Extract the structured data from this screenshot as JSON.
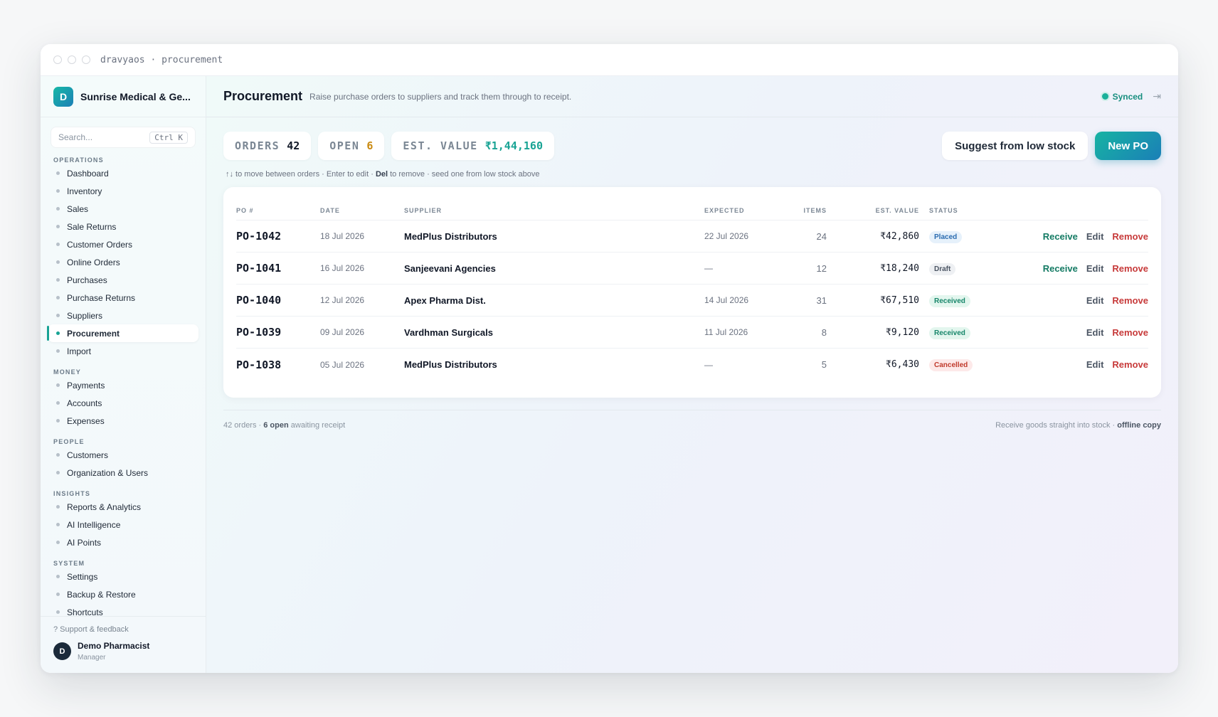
{
  "window": {
    "title": "dravyaos · procurement"
  },
  "sidebar": {
    "org": {
      "logo": "D",
      "name": "Sunrise Medical & Ge..."
    },
    "search": {
      "placeholder": "Search...",
      "shortcut": "Ctrl K"
    },
    "sections": [
      {
        "label": "OPERATIONS",
        "items": [
          "Dashboard",
          "Inventory",
          "Sales",
          "Sale Returns",
          "Customer Orders",
          "Online Orders",
          "Purchases",
          "Purchase Returns",
          "Suppliers",
          "Procurement",
          "Import"
        ]
      },
      {
        "label": "MONEY",
        "items": [
          "Payments",
          "Accounts",
          "Expenses"
        ]
      },
      {
        "label": "PEOPLE",
        "items": [
          "Customers",
          "Organization & Users"
        ]
      },
      {
        "label": "INSIGHTS",
        "items": [
          "Reports & Analytics",
          "AI Intelligence",
          "AI Points"
        ]
      },
      {
        "label": "SYSTEM",
        "items": [
          "Settings",
          "Backup & Restore",
          "Shortcuts"
        ]
      }
    ],
    "active_item": "Procurement",
    "support": "? Support & feedback",
    "user": {
      "initial": "D",
      "name": "Demo Pharmacist",
      "role": "Manager"
    }
  },
  "header": {
    "title": "Procurement",
    "subtitle": "Raise purchase orders to suppliers and track them through to receipt.",
    "sync_status": "Synced"
  },
  "stats": {
    "orders_label": "ORDERS",
    "orders_value": "42",
    "open_label": "OPEN",
    "open_value": "6",
    "value_label": "EST. VALUE",
    "value_value": "₹1,44,160"
  },
  "actions": {
    "suggest": "Suggest from low stock",
    "new_po": "New PO"
  },
  "hint": {
    "part1": "↑↓ to move between orders · Enter to edit · ",
    "del": "Del",
    "part2": " to remove · seed one from low stock above"
  },
  "table": {
    "headers": {
      "po": "PO #",
      "date": "DATE",
      "supplier": "SUPPLIER",
      "expected": "EXPECTED",
      "items": "ITEMS",
      "value": "EST. VALUE",
      "status": "STATUS"
    },
    "rows": [
      {
        "po": "PO-1042",
        "date": "18 Jul 2026",
        "supplier": "MedPlus Distributors",
        "expected": "22 Jul 2026",
        "items": "24",
        "value": "₹42,860",
        "status": "Placed",
        "status_kind": "placed",
        "receive": "Receive",
        "edit": "Edit",
        "remove": "Remove"
      },
      {
        "po": "PO-1041",
        "date": "16 Jul 2026",
        "supplier": "Sanjeevani Agencies",
        "expected": "—",
        "items": "12",
        "value": "₹18,240",
        "status": "Draft",
        "status_kind": "draft",
        "receive": "Receive",
        "edit": "Edit",
        "remove": "Remove"
      },
      {
        "po": "PO-1040",
        "date": "12 Jul 2026",
        "supplier": "Apex Pharma Dist.",
        "expected": "14 Jul 2026",
        "items": "31",
        "value": "₹67,510",
        "status": "Received",
        "status_kind": "received",
        "receive": "",
        "edit": "Edit",
        "remove": "Remove"
      },
      {
        "po": "PO-1039",
        "date": "09 Jul 2026",
        "supplier": "Vardhman Surgicals",
        "expected": "11 Jul 2026",
        "items": "8",
        "value": "₹9,120",
        "status": "Received",
        "status_kind": "received",
        "receive": "",
        "edit": "Edit",
        "remove": "Remove"
      },
      {
        "po": "PO-1038",
        "date": "05 Jul 2026",
        "supplier": "MedPlus Distributors",
        "expected": "—",
        "items": "5",
        "value": "₹6,430",
        "status": "Cancelled",
        "status_kind": "cancelled",
        "receive": "",
        "edit": "Edit",
        "remove": "Remove"
      }
    ]
  },
  "footer": {
    "left_count": "42 orders · ",
    "left_open": "6 open",
    "left_tail": " awaiting receipt",
    "right_text": "Receive goods straight into stock · ",
    "right_bold": "offline copy"
  },
  "colors": {
    "accent": "#17a394",
    "primary_gradient_start": "#17b3a3",
    "primary_gradient_end": "#1b7fb7",
    "danger": "#c73a3a",
    "warning": "#c98a11"
  }
}
